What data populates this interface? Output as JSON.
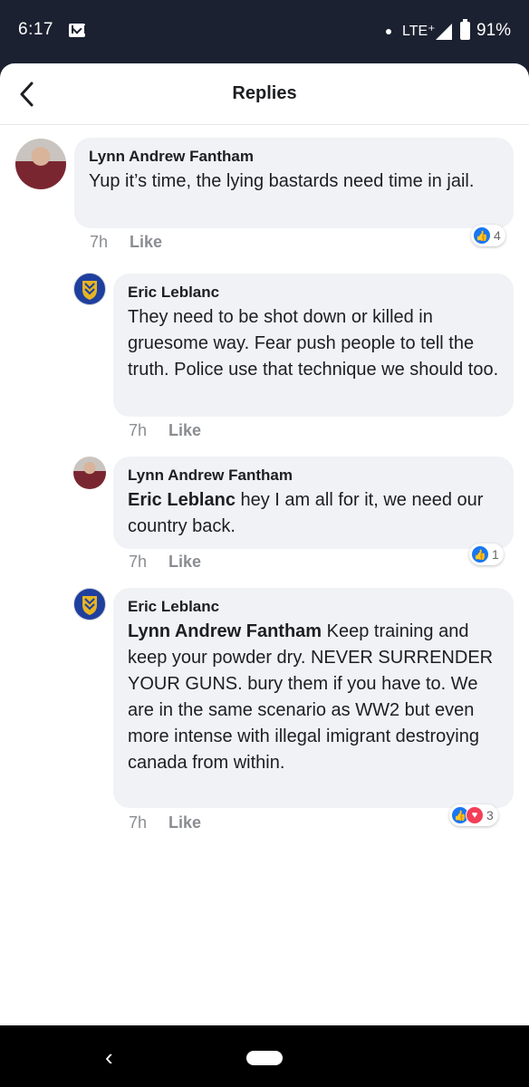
{
  "status_bar": {
    "time": "6:17",
    "network": "LTE⁺",
    "battery": "91%",
    "icons": [
      "gmail-icon",
      "signal-icon",
      "battery-icon"
    ]
  },
  "header": {
    "title": "Replies",
    "back_icon": "chevron-left-icon"
  },
  "comments": [
    {
      "author": "Lynn Andrew Fantham",
      "text": "Yup it’s time, the lying bastards need time in jail.",
      "time": "7h",
      "like_label": "Like",
      "reaction_count": "4"
    },
    {
      "author": "Eric Leblanc",
      "text": "They need to be shot down or killed in gruesome way. Fear push people to tell the truth. Police use that technique we should too.",
      "time": "7h",
      "like_label": "Like"
    },
    {
      "author": "Lynn Andrew Fantham",
      "mention": "Eric Leblanc",
      "text": " hey I am all for it, we need our country back.",
      "time": "7h",
      "like_label": "Like",
      "reaction_count": "1"
    },
    {
      "author": "Eric Leblanc",
      "mention": "Lynn Andrew Fantham",
      "text": " Keep training and keep your powder dry. NEVER SURRENDER YOUR GUNS. bury them if you have to. We are in the same scenario as WW2 but even more intense with illegal imigrant destroying canada from within.",
      "time": "7h",
      "like_label": "Like",
      "reaction_count": "3"
    }
  ],
  "nav_bar": {
    "back_glyph": "‹"
  },
  "colors": {
    "like_blue": "#1877f2",
    "love_red": "#f33e58",
    "bubble_bg": "#f0f2f5",
    "status_bg": "#1c2131"
  }
}
